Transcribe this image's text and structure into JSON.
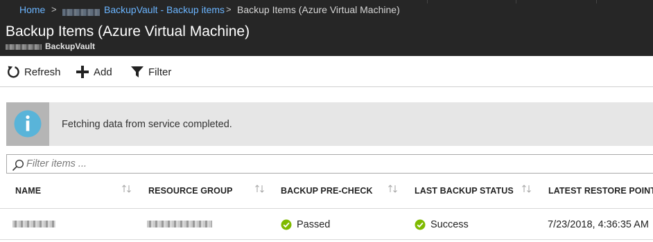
{
  "breadcrumb": {
    "home": "Home",
    "vault_link": "BackupVault - Backup items",
    "current": "Backup Items (Azure Virtual Machine)",
    "separator": ">"
  },
  "header": {
    "title": "Backup Items (Azure Virtual Machine)",
    "subtitle": "BackupVault"
  },
  "toolbar": {
    "refresh_label": "Refresh",
    "add_label": "Add",
    "filter_label": "Filter"
  },
  "banner": {
    "message": "Fetching data from service completed."
  },
  "filter": {
    "placeholder": "Filter items ...",
    "value": ""
  },
  "table": {
    "columns": [
      "NAME",
      "RESOURCE GROUP",
      "BACKUP PRE-CHECK",
      "LAST BACKUP STATUS",
      "LATEST RESTORE POINT"
    ],
    "rows": [
      {
        "backup_pre_check": "Passed",
        "last_backup_status": "Success",
        "latest_restore_point": "7/23/2018, 4:36:35 AM"
      }
    ]
  },
  "colors": {
    "top_bar": "#262626",
    "link": "#6bb5ff",
    "info_icon": "#59b4d9",
    "success": "#7fba00",
    "banner_bg": "#e6e6e6"
  },
  "icons": [
    "refresh-icon",
    "add-icon",
    "filter-icon",
    "info-icon",
    "search-icon",
    "sort-icon",
    "success-check-icon"
  ]
}
